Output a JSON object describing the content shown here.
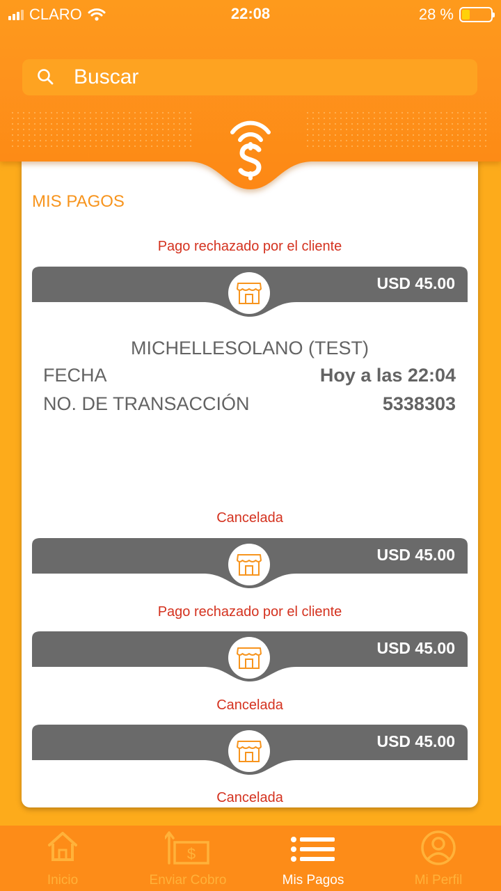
{
  "status_bar": {
    "carrier": "CLARO",
    "time": "22:08",
    "battery": "28 %"
  },
  "search": {
    "placeholder": "Buscar"
  },
  "section_title": "MIS PAGOS",
  "payments": [
    {
      "status": "Pago rechazado por el cliente",
      "amount": "USD 45.00"
    },
    {
      "status": "Cancelada",
      "amount": "USD 45.00"
    },
    {
      "status": "Pago rechazado por el cliente",
      "amount": "USD 45.00"
    },
    {
      "status": "Cancelada",
      "amount": "USD 45.00"
    },
    {
      "status": "Cancelada"
    }
  ],
  "detail": {
    "name": "MICHELLESOLANO (TEST)",
    "date_label": "FECHA",
    "date_value": "Hoy a las 22:04",
    "transaction_label": "NO. DE TRANSACCIÓN",
    "transaction_value": "5338303"
  },
  "nav": [
    {
      "label": "Inicio",
      "icon": "home-icon",
      "active": false
    },
    {
      "label": "Enviar Cobro",
      "icon": "send-charge-icon",
      "active": false
    },
    {
      "label": "Mis Pagos",
      "icon": "list-icon",
      "active": true
    },
    {
      "label": "Mi Perfil",
      "icon": "profile-icon",
      "active": false
    }
  ],
  "colors": {
    "accent": "#fd8c18",
    "status_red": "#d4321f",
    "bar_gray": "#6a6a6a",
    "title_orange": "#f7941d"
  }
}
